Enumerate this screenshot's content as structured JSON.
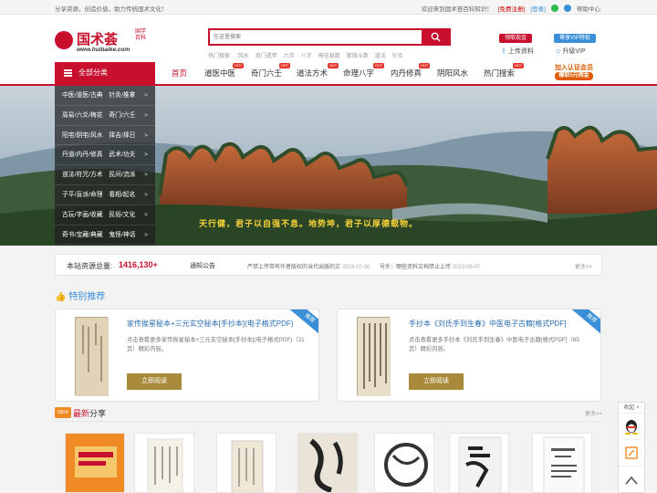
{
  "topbar": {
    "slogan": "分享资源，创造价值，助力传统国术文化！",
    "welcome": "欢迎来到国术荟百科知识！",
    "register": "[免费注册]",
    "login": "[登录]",
    "help": "帮助中心"
  },
  "logo": {
    "name": "国术荟",
    "sub1": "国学",
    "sub2": "百科",
    "url": "www.huibaike.com"
  },
  "search": {
    "placeholder": "在这里搜索",
    "hot_label": "热门搜索:",
    "hot_terms": [
      "风水",
      "奇门遁甲",
      "六爻",
      "八字",
      "梅花易数",
      "紫微斗数",
      "道法",
      "针灸"
    ]
  },
  "header_actions": {
    "btn_cash": "领取现金",
    "btn_vip": "尊享VIP特权",
    "upload": "上传资料",
    "upgrade": "升级VIP"
  },
  "nav": {
    "category_label": "全部分类",
    "items": [
      {
        "label": "首页",
        "badge": ""
      },
      {
        "label": "道医中医",
        "badge": "HOT"
      },
      {
        "label": "奇门六壬",
        "badge": "HOT"
      },
      {
        "label": "道法方术",
        "badge": "HOT"
      },
      {
        "label": "命理八字",
        "badge": "HOT"
      },
      {
        "label": "内丹修真",
        "badge": "HOT"
      },
      {
        "label": "阴阳风水",
        "badge": ""
      },
      {
        "label": "热门搜索",
        "badge": "HOT"
      }
    ],
    "promo_line1": "加入认证会员",
    "promo_line2": "赚取5元佣金"
  },
  "side_menu": [
    "中医/道医/古典　针灸/推拿",
    "周易/六爻/梅花　奇门/六壬",
    "阳宅/阴宅/风水　择吉/择日",
    "丹道/内丹/修真　武术/功夫",
    "道法/符咒/方术　民间/流派",
    "子平/盲派/命理　看相/起名",
    "古玩/字画/收藏　民俗/文化",
    "奇书/宝藏/典藏　鬼怪/神话"
  ],
  "banner": {
    "caption": "天行健，君子以自强不息。地势坤，君子以厚德载物。"
  },
  "stats": {
    "label": "本站资源总量:",
    "count": "1416,130+",
    "announce": "通知公告",
    "notice1": "严禁上传带有作者版权的当代出版的文",
    "notice1_date": "2024-10-30",
    "notice2": "号外：哪些资料文档禁止上传",
    "notice2_date": "2023-08-07",
    "more": "更多>>"
  },
  "featured": {
    "title": "特别推荐",
    "read_label": "立即阅读",
    "corner": "推荐",
    "cards": [
      {
        "title": "家传挨星秘本+三元玄空秘本[手抄本](电子格式PDF)",
        "desc": "点击查看更多家传挨星秘本+三元玄空秘本[手抄本](电子格式PDF)（21页）精彩内容。"
      },
      {
        "title": "手抄本《刘氏手到生春》中医电子古籍[格式PDF]",
        "desc": "点击查看更多手抄本《刘氏手到生春》中医电子古籍[格式PDF]（85页）精彩内容。"
      }
    ]
  },
  "latest": {
    "tag": "NEW",
    "title_a": "最新",
    "title_b": "分享",
    "more": "更多>>"
  },
  "floating": {
    "collapse": "收起"
  },
  "colors": {
    "brand_red": "#c8102e",
    "link_blue": "#3a8fd8",
    "read_gold": "#a88a3a"
  }
}
